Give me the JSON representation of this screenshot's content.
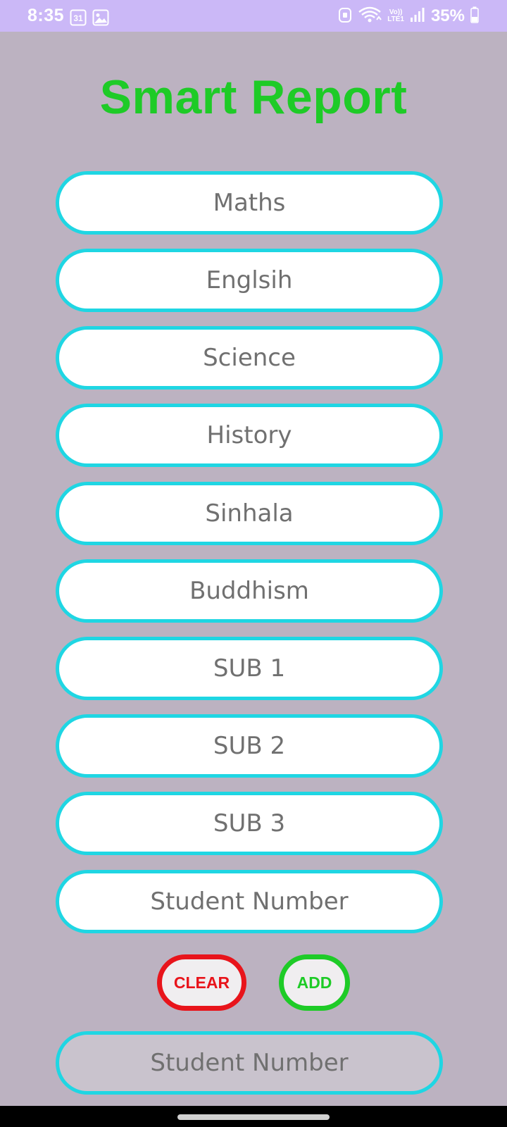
{
  "status_bar": {
    "time": "8:35",
    "calendar_badge": "31",
    "battery_percent": "35%",
    "network_label_top": "Vo))",
    "network_label_bottom": "LTE1"
  },
  "app": {
    "title": "Smart Report"
  },
  "fields": [
    {
      "placeholder": "Maths"
    },
    {
      "placeholder": "Englsih"
    },
    {
      "placeholder": "Science"
    },
    {
      "placeholder": "History"
    },
    {
      "placeholder": "Sinhala"
    },
    {
      "placeholder": "Buddhism"
    },
    {
      "placeholder": "SUB 1"
    },
    {
      "placeholder": "SUB 2"
    },
    {
      "placeholder": "SUB 3"
    },
    {
      "placeholder": "Student Number"
    }
  ],
  "buttons": {
    "clear_label": "CLEAR",
    "add_label": "ADD"
  },
  "result_field": {
    "placeholder": "Student Number"
  },
  "colors": {
    "background": "#bcb2c1",
    "status_bar": "#cbb8f7",
    "title_green": "#1ecb27",
    "field_border_cyan": "#1fd6e3",
    "clear_red": "#e8141b",
    "add_green": "#1ecb27",
    "placeholder_gray": "#707070"
  }
}
